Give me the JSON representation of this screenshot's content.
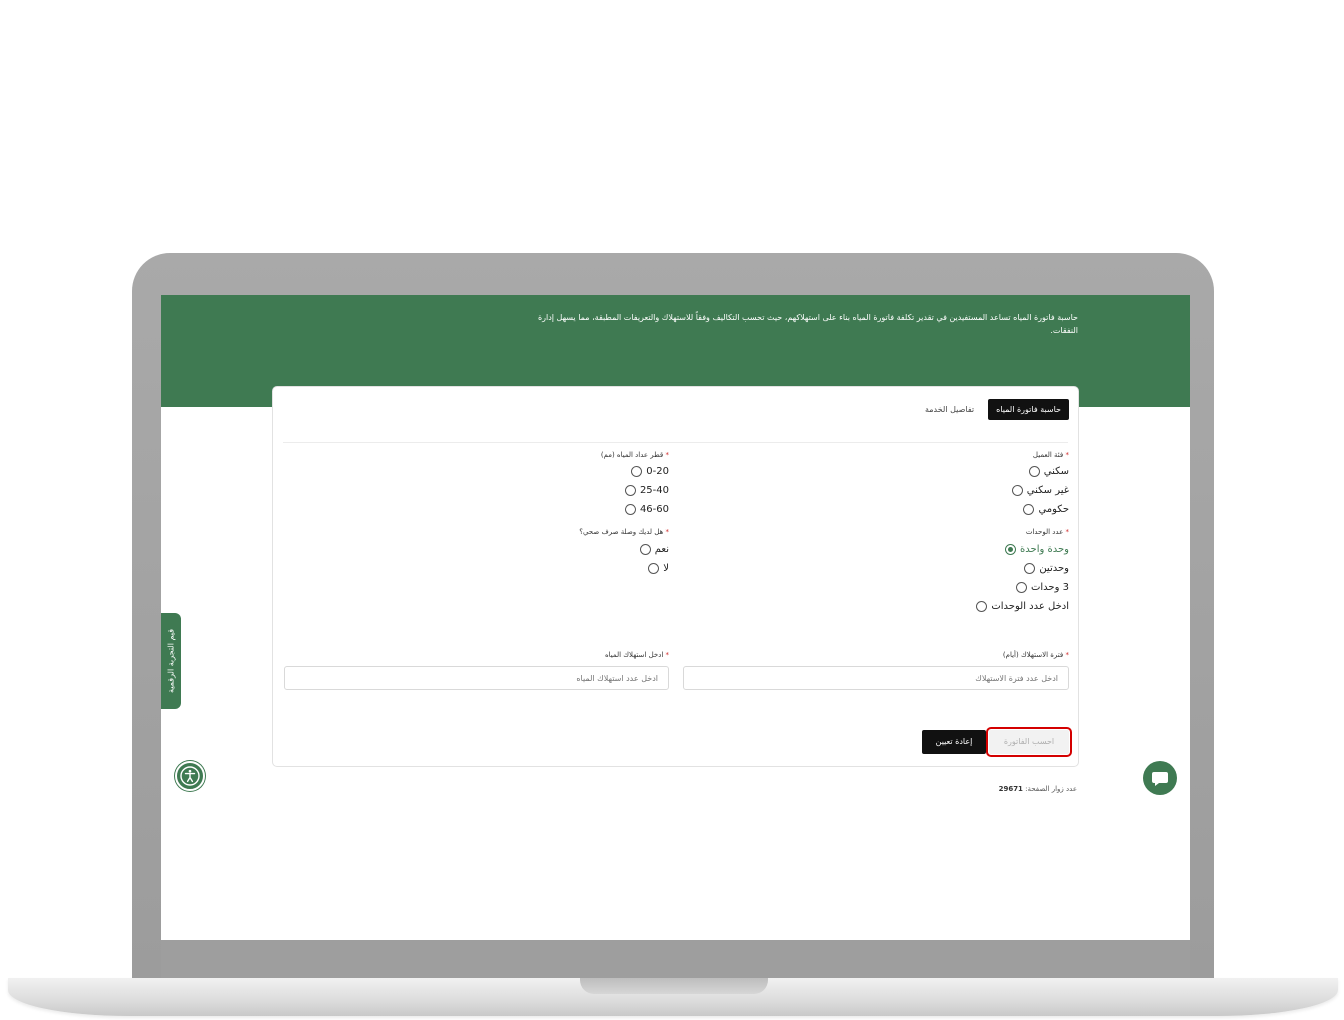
{
  "hero": {
    "description": "حاسبة فاتورة المياه تساعد المستفيدين في تقدير تكلفة فاتورة المياه بناء على استهلاكهم، حيث تحسب التكاليف وفقاً للاستهلاك والتعريفات المطبقة، مما يسهل إدارة النفقات."
  },
  "tabs": [
    {
      "label": "حاسبة فاتورة المياه",
      "active": true
    },
    {
      "label": "تفاصيل الخدمة",
      "active": false
    }
  ],
  "form": {
    "customer_category": {
      "label": "فئة العميل",
      "options": [
        "سكني",
        "غير سكني",
        "حكومي"
      ]
    },
    "meter_diameter": {
      "label": "قطر عداد المياه (مم)",
      "options": [
        "0-20",
        "25-40",
        "46-60"
      ]
    },
    "units_count": {
      "label": "عدد الوحدات",
      "options": [
        "وحدة واحدة",
        "وحدتين",
        "3 وحدات",
        "ادخل عدد الوحدات"
      ],
      "selected": "وحدة واحدة"
    },
    "sewage": {
      "label": "هل لديك وصلة صرف صحي؟",
      "options": [
        "نعم",
        "لا"
      ]
    },
    "period": {
      "label": "فترة الاستهلاك (أيام)",
      "placeholder": "ادخل عدد فترة الاستهلاك"
    },
    "consumption": {
      "label": "ادخل استهلاك المياه",
      "placeholder": "ادخل عدد استهلاك المياه"
    },
    "required_mark": "*"
  },
  "buttons": {
    "calculate": "احسب الفاتورة",
    "reset": "إعادة تعيين"
  },
  "footer": {
    "visits_label": "عدد زوار الصفحة:",
    "visits_count": "29671"
  },
  "side_tab": {
    "label": "قيم التجربة الرقمية"
  },
  "icons": {
    "accessibility": "accessibility-icon",
    "chat": "chat-icon"
  },
  "colors": {
    "brand_green": "#3f7a52",
    "highlight_red": "#d40000"
  }
}
